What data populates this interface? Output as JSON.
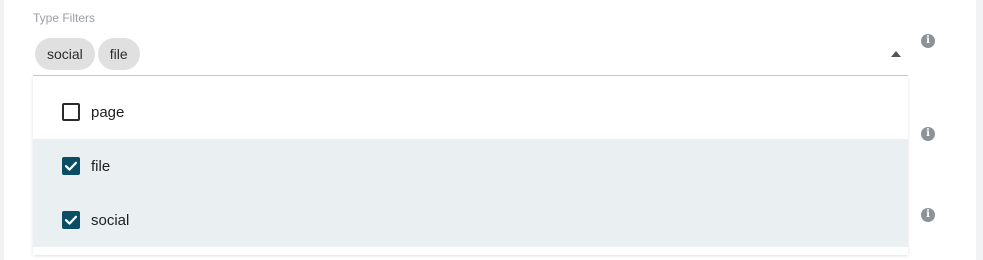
{
  "type_filters": {
    "label": "Type Filters",
    "selected_chips": [
      "social",
      "file"
    ],
    "options": [
      {
        "label": "page",
        "checked": false
      },
      {
        "label": "file",
        "checked": true
      },
      {
        "label": "social",
        "checked": true
      }
    ],
    "info_icon": "info-icon",
    "caret_icon": "caret-up-icon"
  },
  "colors": {
    "checkbox_checked": "#0b4d64",
    "selected_row": "#eaeff2",
    "chip_bg": "#e0e0e0",
    "info_icon": "#8e9196"
  }
}
